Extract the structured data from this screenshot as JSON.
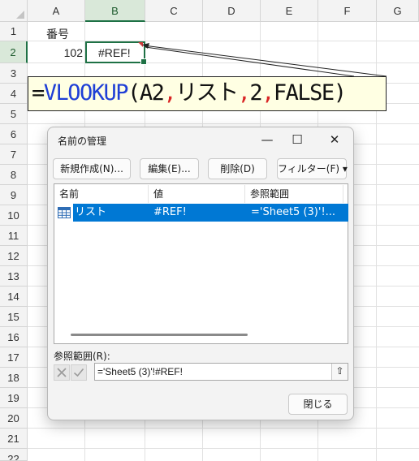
{
  "sheet": {
    "columns": [
      "A",
      "B",
      "C",
      "D",
      "E",
      "F",
      "G"
    ],
    "rows": [
      "1",
      "2",
      "3",
      "4",
      "5",
      "6",
      "7",
      "8",
      "9",
      "10",
      "11",
      "12",
      "13",
      "14",
      "15",
      "16",
      "17",
      "18",
      "19",
      "20",
      "21",
      "22"
    ],
    "a1": "番号",
    "a2": "102",
    "b2": "#REF!"
  },
  "formula": {
    "eq": "=",
    "fn": "VLOOKUP",
    "open": "(",
    "arg1": "A2",
    "sep1": ",",
    "arg2": "リスト",
    "sep2": ",",
    "arg3": "2",
    "sep3": ",",
    "arg4": "FALSE",
    "close": ")"
  },
  "dialog": {
    "title": "名前の管理",
    "minimize": "—",
    "maximize": "☐",
    "close": "✕",
    "buttons": {
      "new": "新規作成(N)...",
      "edit": "編集(E)...",
      "delete": "削除(D)",
      "filter": "フィルター(F) ▾"
    },
    "list": {
      "headers": [
        "名前",
        "値",
        "参照範囲"
      ],
      "rows": [
        {
          "name": "リスト",
          "value": "#REF!",
          "refers_to": "='Sheet5 (3)'!..."
        }
      ]
    },
    "refers_label": "参照範囲(R):",
    "refers_value": "='Sheet5 (3)'!#REF!",
    "collapse_icon": "⇧",
    "close_button": "閉じる"
  },
  "colors": {
    "selection": "#1e7145",
    "formula_function": "#1f3fd6",
    "formula_separator": "#d92424",
    "list_highlight": "#0078d4"
  }
}
